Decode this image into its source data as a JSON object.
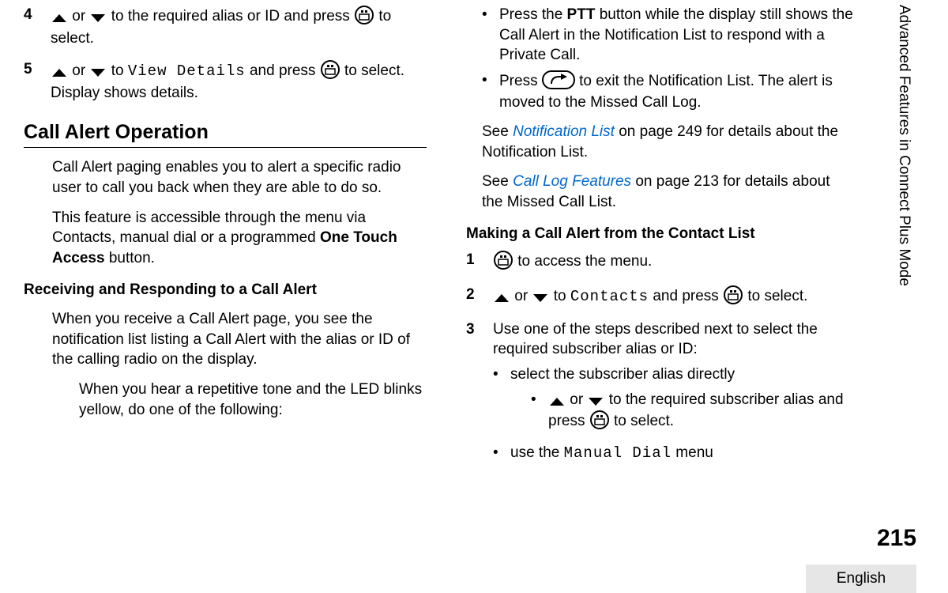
{
  "chapter": "Advanced Features in Connect Plus Mode",
  "page_number": "215",
  "language": "English",
  "left": {
    "step4": {
      "num": "4",
      "t1": " or ",
      "t2": " to the required alias or ID and press ",
      "t3": " to select."
    },
    "step5": {
      "num": "5",
      "t1": " or ",
      "t2": " to ",
      "menu": "View Details",
      "t3": " and press ",
      "t4": " to select.",
      "t5": "Display shows details."
    },
    "h_call_alert_op": "Call Alert Operation",
    "p1": "Call Alert paging enables you to alert a specific radio user to call you back when they are able to do so.",
    "p2a": "This feature is accessible through the menu via Contacts, manual dial or a programmed ",
    "p2b": "One Touch Access",
    "p2c": " button.",
    "h_recv": "Receiving and Responding to a Call Alert",
    "p3": "When you receive a Call Alert page, you see the notification list listing a Call Alert with the alias or ID of the calling radio on the display.",
    "p4": "When you hear a repetitive tone and the LED blinks yellow, do one of the following:"
  },
  "right": {
    "b1a": "Press the ",
    "b1b": "PTT",
    "b1c": " button while the display still shows the Call Alert in the Notification List to respond with a Private Call.",
    "b2a": "Press ",
    "b2b": " to exit the Notification List. The alert is moved to the Missed Call Log.",
    "see1a": "See ",
    "see1link": "Notification List",
    "see1b": " on page 249 for details about the Notification List.",
    "see2a": "See ",
    "see2link": "Call Log Features",
    "see2b": " on page 213 for details about the Missed Call List.",
    "h_making": "Making a Call Alert from the Contact List",
    "s1": {
      "num": "1",
      "t": " to access the menu."
    },
    "s2": {
      "num": "2",
      "t1": " or ",
      "t2": " to ",
      "menu": "Contacts",
      "t3": " and press ",
      "t4": " to select."
    },
    "s3": {
      "num": "3",
      "t": "Use one of the steps described next to select the required subscriber alias or ID:"
    },
    "s3_b1": "select the subscriber alias directly",
    "s3_b1_sub_a": " or ",
    "s3_b1_sub_b": " to the required subscriber alias and press ",
    "s3_b1_sub_c": " to select.",
    "s3_b2a": "use the ",
    "s3_b2menu": "Manual Dial",
    "s3_b2b": " menu"
  }
}
